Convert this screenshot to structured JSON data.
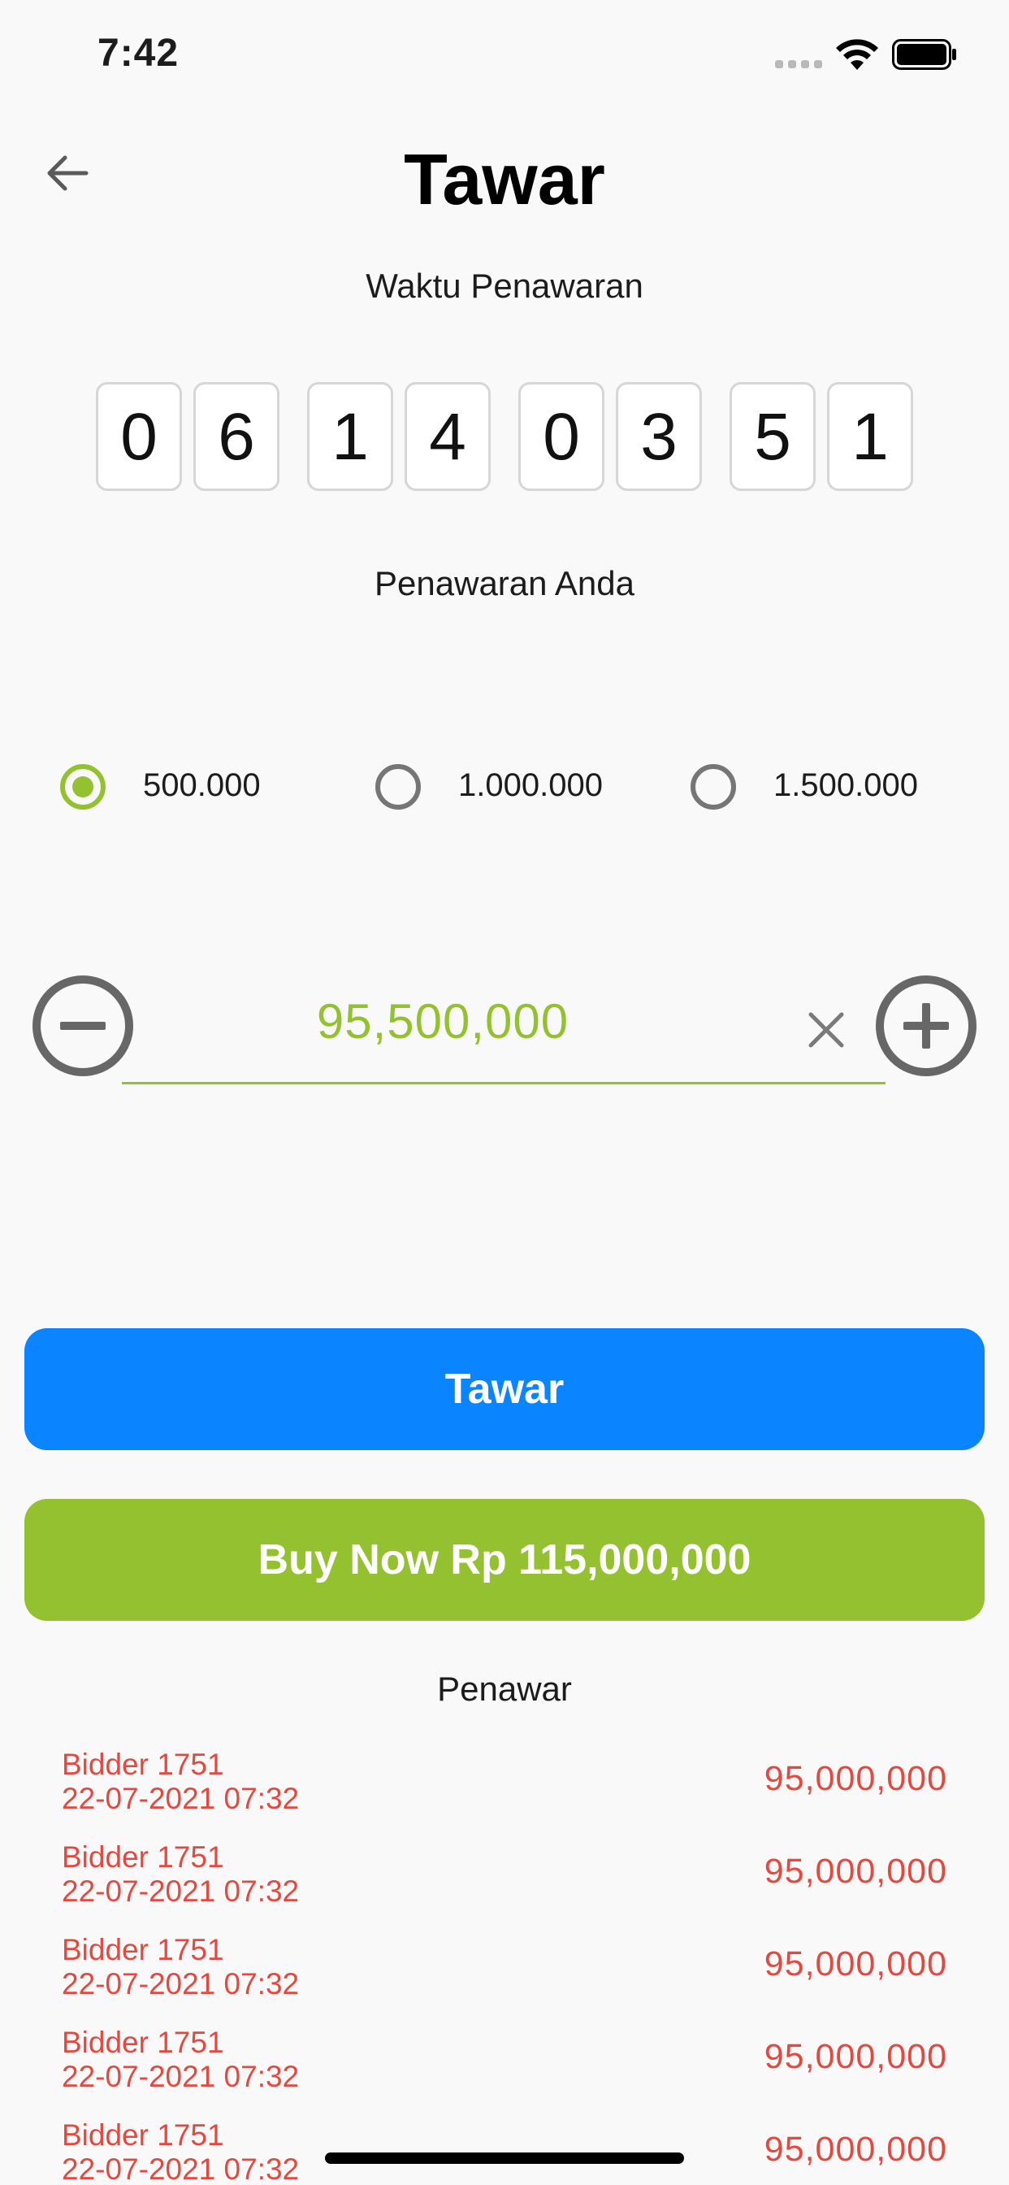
{
  "status_bar": {
    "time": "7:42"
  },
  "header": {
    "title": "Tawar"
  },
  "timer": {
    "label": "Waktu Penawaran",
    "digits": [
      "0",
      "6",
      "1",
      "4",
      "0",
      "3",
      "5",
      "1"
    ]
  },
  "bid": {
    "label": "Penawaran Anda",
    "increments": [
      {
        "label": "500.000",
        "selected": true
      },
      {
        "label": "1.000.000",
        "selected": false
      },
      {
        "label": "1.500.000",
        "selected": false
      }
    ],
    "amount": "95,500,000"
  },
  "actions": {
    "bid_label": "Tawar",
    "buy_now_label": "Buy Now Rp 115,000,000"
  },
  "bidders": {
    "label": "Penawar",
    "rows": [
      {
        "name": "Bidder 1751",
        "date": "22-07-2021 07:32",
        "amount": "95,000,000"
      },
      {
        "name": "Bidder 1751",
        "date": "22-07-2021 07:32",
        "amount": "95,000,000"
      },
      {
        "name": "Bidder 1751",
        "date": "22-07-2021 07:32",
        "amount": "95,000,000"
      },
      {
        "name": "Bidder 1751",
        "date": "22-07-2021 07:32",
        "amount": "95,000,000"
      },
      {
        "name": "Bidder 1751",
        "date": "22-07-2021 07:32",
        "amount": "95,000,000"
      }
    ]
  },
  "colors": {
    "accent_green": "#94c12f",
    "primary_blue": "#0a84ff",
    "bid_red": "#e5483f",
    "background": "#f9f9f9"
  }
}
